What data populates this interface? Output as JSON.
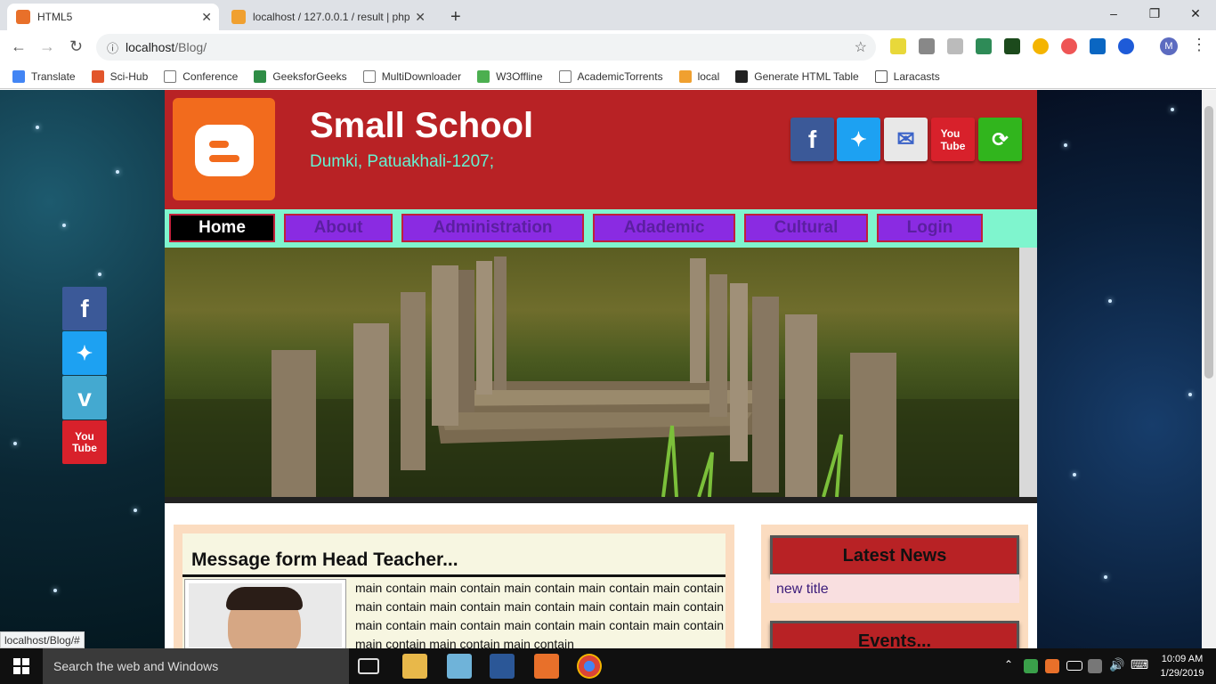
{
  "browser": {
    "tabs": [
      {
        "title": "HTML5",
        "active": true
      },
      {
        "title": "localhost / 127.0.0.1 / result | php",
        "active": false
      }
    ],
    "new_tab": "+",
    "url_host": "localhost",
    "url_path": "/Blog/",
    "bookmarks": [
      "Translate",
      "Sci-Hub",
      "Conference",
      "GeeksforGeeks",
      "MultiDownloader",
      "W3Offline",
      "AcademicTorrents",
      "local",
      "Generate HTML Table",
      "Laracasts"
    ],
    "profile_initial": "M"
  },
  "header": {
    "title": "Small School",
    "subtitle": "Dumki, Patuakhali-1207;",
    "header_color": "#b82225",
    "social": [
      "facebook-icon",
      "twitter-icon",
      "email-icon",
      "youtube-icon",
      "share-icon"
    ]
  },
  "nav": {
    "items": [
      "Home",
      "About",
      "Administration",
      "Adademic",
      "Cultural",
      "Login"
    ],
    "active": "Home"
  },
  "main": {
    "message_title": "Message form Head Teacher...",
    "message_text": "main contain main contain main contain main contain main contain main contain main contain main contain main contain main contain main contain main contain main contain main contain main contain main contain main contain main contain"
  },
  "sidebar": {
    "latest_news_title": "Latest News",
    "news_items": [
      "new title"
    ],
    "events_title": "Events..."
  },
  "floating_social": [
    "facebook-icon",
    "twitter-icon",
    "vimeo-icon",
    "youtube-icon"
  ],
  "status_bar": "localhost/Blog/#",
  "taskbar": {
    "search_placeholder": "Search the web and Windows",
    "time": "10:09 AM",
    "date": "1/29/2019"
  }
}
